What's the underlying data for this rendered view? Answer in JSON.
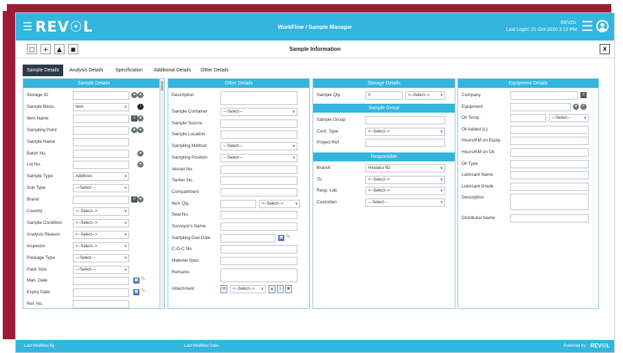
{
  "header": {
    "logo": "REV☉L",
    "workflow": "WorkFlow / Sample Manager",
    "user": "REVOL",
    "last_login": "Last Login: 21-Oct-2020 3:12 PM"
  },
  "toolbar": {
    "icons": [
      "save-icon",
      "add-icon",
      "upload-icon",
      "delete-icon"
    ],
    "title": "Sample Information",
    "close": "x"
  },
  "tabs": [
    "Sample Details",
    "Analysis Details",
    "Specification",
    "Additional Details",
    "Other Details"
  ],
  "sample_details": {
    "title": "Sample Details",
    "fields": [
      {
        "label": "Storage ID",
        "value": ""
      },
      {
        "label": "Sample Basis",
        "value": "Item"
      },
      {
        "label": "Item Name",
        "value": ""
      },
      {
        "label": "Sampling Point",
        "value": ""
      },
      {
        "label": "Sample Name",
        "value": ""
      },
      {
        "label": "Batch No.",
        "value": ""
      },
      {
        "label": "Lot No.",
        "value": ""
      },
      {
        "label": "Sample Type",
        "value": "Additives"
      },
      {
        "label": "Sub Type",
        "value": "---Select---"
      },
      {
        "label": "Brand",
        "value": ""
      },
      {
        "label": "Country",
        "value": "<--Select-->"
      },
      {
        "label": "Sample Condition",
        "value": "<--Select-->"
      },
      {
        "label": "Analysis Reason",
        "value": "<--Select-->"
      },
      {
        "label": "Inspector",
        "value": "<--Select-->"
      },
      {
        "label": "Package Type",
        "value": "---Select---"
      },
      {
        "label": "Pack Size",
        "value": "---Select---"
      },
      {
        "label": "Man. Date",
        "value": ""
      },
      {
        "label": "Expiry Date",
        "value": ""
      },
      {
        "label": "Ref. No.",
        "value": ""
      }
    ]
  },
  "other_details": {
    "title": "Other Details",
    "fields": [
      {
        "label": "Description",
        "value": ""
      },
      {
        "label": "Sample Container",
        "value": "---Select---"
      },
      {
        "label": "Sample Source",
        "value": ""
      },
      {
        "label": "Sample Location",
        "value": ""
      },
      {
        "label": "Sampling Method",
        "value": "---Select---"
      },
      {
        "label": "Sampling Position",
        "value": "---Select---"
      },
      {
        "label": "Vessel No.",
        "value": ""
      },
      {
        "label": "Tanker No.",
        "value": ""
      },
      {
        "label": "Compartment",
        "value": ""
      },
      {
        "label": "Item Qty.",
        "value": "",
        "unit": "<--Select-->"
      },
      {
        "label": "Seal No.",
        "value": ""
      },
      {
        "label": "Surveyor's Name",
        "value": ""
      },
      {
        "label": "Sampling Due Date",
        "value": ""
      },
      {
        "label": "C-O-C No.",
        "value": ""
      },
      {
        "label": "Material Spec",
        "value": ""
      },
      {
        "label": "Remarks",
        "value": ""
      },
      {
        "label": "Attachment",
        "value": "<--Select-->"
      }
    ]
  },
  "storage_details": {
    "title": "Storage Details",
    "qty_label": "Sample Qty.",
    "qty_value": "0",
    "qty_unit": "<--Select-->",
    "group_title": "Sample Group",
    "group_fields": [
      {
        "label": "Sample Group",
        "value": ""
      },
      {
        "label": "Cont. Type",
        "value": "<--Select-->"
      },
      {
        "label": "Project Ref.",
        "value": ""
      }
    ],
    "resp_title": "Responsible",
    "resp_fields": [
      {
        "label": "Branch",
        "value": "Hindalco B2"
      },
      {
        "label": "To",
        "value": "<--Select-->"
      },
      {
        "label": "Resp. Lab",
        "value": "<--Select-->"
      },
      {
        "label": "Custodian",
        "value": "---Select---"
      }
    ]
  },
  "equipment_details": {
    "title": "Equipment Details",
    "fields": [
      {
        "label": "Company",
        "value": ""
      },
      {
        "label": "Equipment",
        "value": ""
      },
      {
        "label": "Oil Temp.",
        "value": "",
        "unit": "---Select---"
      },
      {
        "label": "Oil Added (L)",
        "value": ""
      },
      {
        "label": "Hours/KM on Equip.",
        "value": ""
      },
      {
        "label": "Hours/KM on Oil",
        "value": ""
      },
      {
        "label": "Oil Type",
        "value": ""
      },
      {
        "label": "Lubricant Name",
        "value": ""
      },
      {
        "label": "Lubricant Grade",
        "value": ""
      },
      {
        "label": "Description",
        "value": ""
      },
      {
        "label": "Distributor Name",
        "value": ""
      }
    ]
  },
  "footer": {
    "last_modified_by": "Last Modified By",
    "last_modified_date": "Last Modified Date",
    "powered_by": "Powered by -",
    "powered_logo": "REV☉L"
  }
}
